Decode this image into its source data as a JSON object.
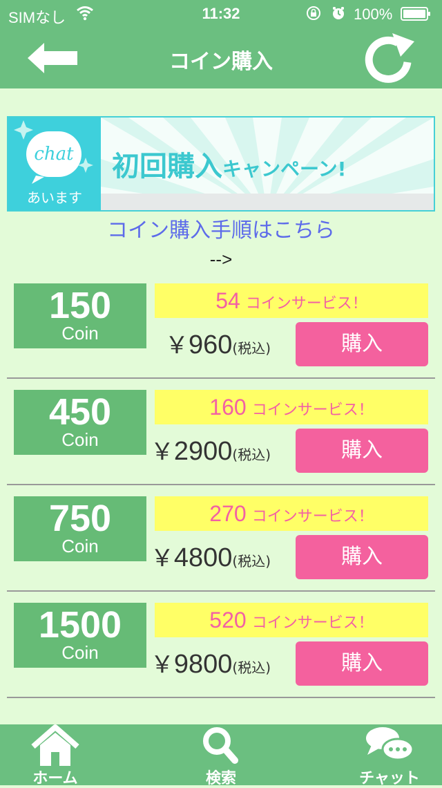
{
  "status_bar": {
    "carrier": "SIMなし",
    "time": "11:32",
    "battery_percent": "100%"
  },
  "nav": {
    "title": "コイン購入"
  },
  "banner": {
    "logo_text": "chat",
    "logo_subtitle": "あいます",
    "campaign_main": "初回購入",
    "campaign_sub": "キャンペーン!"
  },
  "howto_link": "コイン購入手順はこちら",
  "arrow_text": "-->",
  "packages": [
    {
      "coins": "150",
      "unit": "Coin",
      "bonus": "54",
      "bonus_text": "コインサービス！",
      "yen": "￥",
      "price": "960",
      "tax": "(税込)",
      "buy_label": "購入"
    },
    {
      "coins": "450",
      "unit": "Coin",
      "bonus": "160",
      "bonus_text": "コインサービス！",
      "yen": "￥",
      "price": "2900",
      "tax": "(税込)",
      "buy_label": "購入"
    },
    {
      "coins": "750",
      "unit": "Coin",
      "bonus": "270",
      "bonus_text": "コインサービス！",
      "yen": "￥",
      "price": "4800",
      "tax": "(税込)",
      "buy_label": "購入"
    },
    {
      "coins": "1500",
      "unit": "Coin",
      "bonus": "520",
      "bonus_text": "コインサービス！",
      "yen": "￥",
      "price": "9800",
      "tax": "(税込)",
      "buy_label": "購入"
    }
  ],
  "tabs": [
    {
      "label": "ホーム",
      "icon": "home-icon"
    },
    {
      "label": "検索",
      "icon": "search-icon"
    },
    {
      "label": "チャット",
      "icon": "chat-icon"
    }
  ],
  "colors": {
    "header_green": "#6bbf80",
    "background": "#e3fbd8",
    "coin_box": "#66bb76",
    "service_yellow": "#ffff66",
    "service_text": "#f260a4",
    "buy_pink": "#f4619e",
    "link_blue": "#5d6bea",
    "banner_teal": "#3ed0dc"
  }
}
